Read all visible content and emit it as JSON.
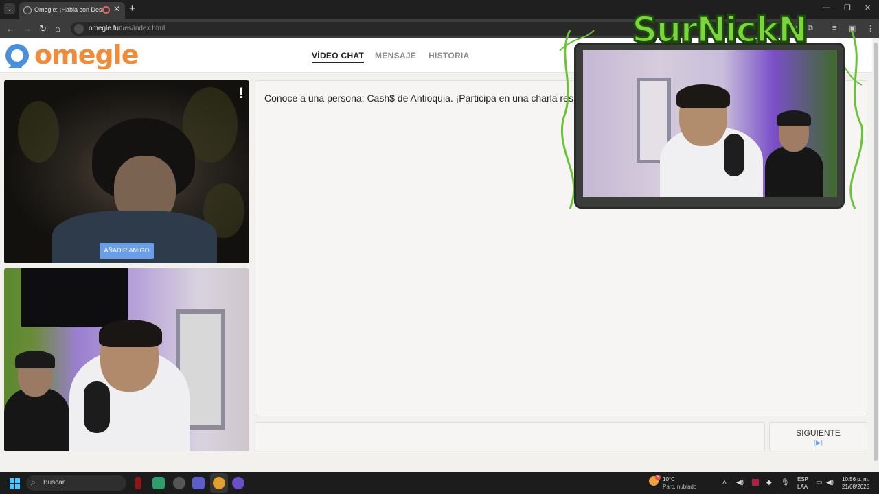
{
  "browser": {
    "tab_title": "Omegle: ¡Habla con Descon",
    "url_host": "omegle.fun",
    "url_path": "/es/index.html"
  },
  "site": {
    "logo_text": "omegle",
    "nav": [
      "VÍDEO CHAT",
      "MENSAJE",
      "HISTORIA"
    ],
    "add_friend_label": "AÑADIR AMIGO",
    "report_label": "!",
    "chat_message": "Conoce a una persona: Cash$ de Antioquia. ¡Participa en una charla respetu",
    "next_label": "SIGUIENTE",
    "next_arrow": "(▶)"
  },
  "overlay": {
    "title": "SurNickN"
  },
  "taskbar": {
    "search_placeholder": "Buscar",
    "weather_temp": "10°C",
    "weather_desc": "Parc. nublado",
    "weather_badge": "5",
    "lang_line1": "ESP",
    "lang_line2": "LAA",
    "time": "10:56 p. m.",
    "date": "21/08/2025"
  },
  "colors": {
    "brand_orange": "#f08b3a",
    "brand_blue": "#4a8fd8",
    "button_blue": "#6a9ee6",
    "overlay_green": "#7bd63a"
  }
}
